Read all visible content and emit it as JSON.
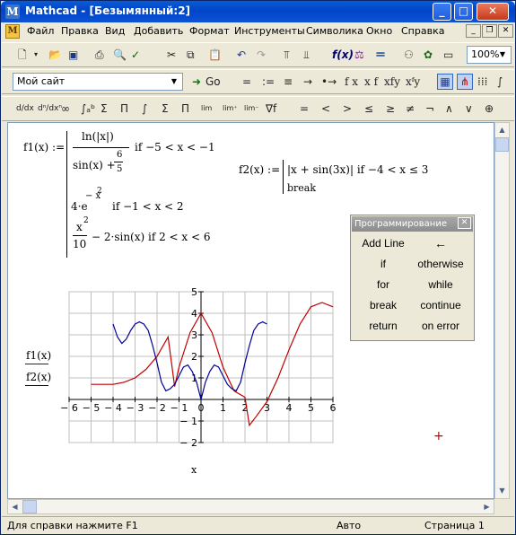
{
  "window": {
    "title": "Mathcad - [Безымянный:2]",
    "app_icon": "M"
  },
  "menu": [
    "Файл",
    "Правка",
    "Вид",
    "Добавить",
    "Формат",
    "Инструменты",
    "Символика",
    "Окно",
    "Справка"
  ],
  "toolbar2": {
    "site_value": "Мой сайт",
    "go_label": "Go",
    "eval_buttons": [
      "=",
      ":=",
      "≡",
      "→",
      "•→",
      "f x",
      "x f",
      "xfy",
      "xᶠy"
    ]
  },
  "zoom": "100%",
  "calculus": {
    "ops": [
      "=",
      "<",
      ">",
      "≤",
      "≥",
      "≠",
      "¬",
      "∧",
      "∨",
      "⊕"
    ]
  },
  "worksheet": {
    "f1": {
      "lhs": "f1(x) :=",
      "case1_num": "ln(|x|)",
      "case1_den_a": "sin(x) +",
      "case1_den_b_num": "6",
      "case1_den_b_den": "5",
      "case1_cond": "if  −5 < x < −1",
      "case2_expr": "4·e",
      "case2_exp": "− x",
      "case2_exp2": "2",
      "case2_cond": "if  −1 < x < 2",
      "case3_num": "x",
      "case3_num_exp": "2",
      "case3_den": "10",
      "case3_rest": "− 2·sin(x)  if  2 < x < 6"
    },
    "f2": {
      "lhs": "f2(x) :=",
      "line1": "|x + sin(3x)|  if  −4 < x ≤ 3",
      "line2": "break"
    },
    "plot": {
      "ylabel1": "f1(x)",
      "ylabel2": "f2(x)",
      "xlabel": "x"
    }
  },
  "panel": {
    "title": "Программирование",
    "buttons": [
      "Add Line",
      "←",
      "if",
      "otherwise",
      "for",
      "while",
      "break",
      "continue",
      "return",
      "on error"
    ]
  },
  "status": {
    "help": "Для справки нажмите F1",
    "mode": "Авто",
    "page": "Страница 1"
  },
  "chart_data": {
    "type": "line",
    "xlim": [
      -6,
      6
    ],
    "ylim": [
      -2,
      5
    ],
    "xticks": [
      -6,
      -5,
      -4,
      -3,
      -2,
      -1,
      0,
      1,
      2,
      3,
      4,
      5,
      6
    ],
    "yticks": [
      -2,
      -1,
      0,
      1,
      2,
      3,
      4,
      5
    ],
    "xlabel": "x",
    "ylabel": "f1(x), f2(x)",
    "grid": true,
    "series": [
      {
        "name": "f1(x)",
        "color": "#c00000",
        "x": [
          -5,
          -4.5,
          -4,
          -3.5,
          -3,
          -2.5,
          -2,
          -1.5,
          -1.2,
          -1,
          -0.5,
          0,
          0.5,
          1,
          1.5,
          2,
          2.2,
          2.5,
          3,
          3.5,
          4,
          4.5,
          5,
          5.5,
          6
        ],
        "y": [
          0.7,
          0.7,
          0.7,
          0.8,
          1.0,
          1.4,
          2.0,
          2.9,
          0.6,
          1.5,
          3.1,
          4.0,
          3.1,
          1.5,
          0.4,
          0.1,
          -1.2,
          -0.8,
          -0.1,
          1.0,
          2.3,
          3.5,
          4.3,
          4.5,
          4.3
        ]
      },
      {
        "name": "f2(x)",
        "color": "#00009a",
        "x": [
          -4,
          -3.8,
          -3.6,
          -3.4,
          -3.2,
          -3,
          -2.8,
          -2.6,
          -2.4,
          -2.2,
          -2,
          -1.8,
          -1.6,
          -1.4,
          -1.2,
          -1,
          -0.8,
          -0.6,
          -0.4,
          -0.2,
          0,
          0.2,
          0.4,
          0.6,
          0.8,
          1,
          1.2,
          1.4,
          1.6,
          1.8,
          2,
          2.2,
          2.4,
          2.6,
          2.8,
          3
        ],
        "y": [
          3.5,
          2.9,
          2.6,
          2.8,
          3.2,
          3.5,
          3.6,
          3.5,
          3.2,
          2.5,
          1.7,
          0.8,
          0.4,
          0.5,
          0.7,
          1.1,
          1.5,
          1.6,
          1.3,
          0.8,
          0.0,
          0.8,
          1.3,
          1.6,
          1.5,
          1.1,
          0.7,
          0.5,
          0.4,
          0.8,
          1.7,
          2.5,
          3.2,
          3.5,
          3.6,
          3.5
        ]
      }
    ]
  }
}
